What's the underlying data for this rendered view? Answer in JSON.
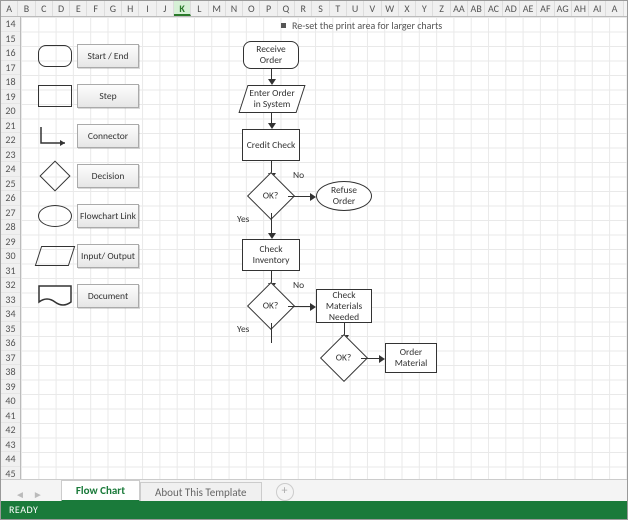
{
  "hint": {
    "text": "Re-set the print area for larger charts"
  },
  "columns": [
    "A",
    "B",
    "C",
    "D",
    "E",
    "F",
    "G",
    "H",
    "I",
    "J",
    "K",
    "L",
    "M",
    "N",
    "O",
    "P",
    "Q",
    "R",
    "S",
    "T",
    "U",
    "V",
    "W",
    "X",
    "Y",
    "Z",
    "AA",
    "AB",
    "AC",
    "AD",
    "AE",
    "AF",
    "AG",
    "AH",
    "AI",
    "A"
  ],
  "selected_col": "K",
  "rows_start": 14,
  "rows_end": 45,
  "legend": {
    "start_end": "Start / End",
    "step": "Step",
    "connector": "Connector",
    "decision": "Decision",
    "flowchart_link": "Flowchart Link",
    "input_output": "Input/ Output",
    "document": "Document"
  },
  "flow": {
    "receive_order": "Receive Order",
    "enter_order": "Enter Order in System",
    "credit_check": "Credit Check",
    "ok1": "OK?",
    "ok1_no": "No",
    "ok1_yes": "Yes",
    "refuse_order": "Refuse Order",
    "check_inventory": "Check Inventory",
    "ok2": "OK?",
    "ok2_no": "No",
    "ok2_yes": "Yes",
    "check_materials": "Check Materials Needed",
    "ok3": "OK?",
    "order_material": "Order Material"
  },
  "tabs": {
    "active": "Flow Chart",
    "second": "About This Template"
  },
  "status": "READY"
}
